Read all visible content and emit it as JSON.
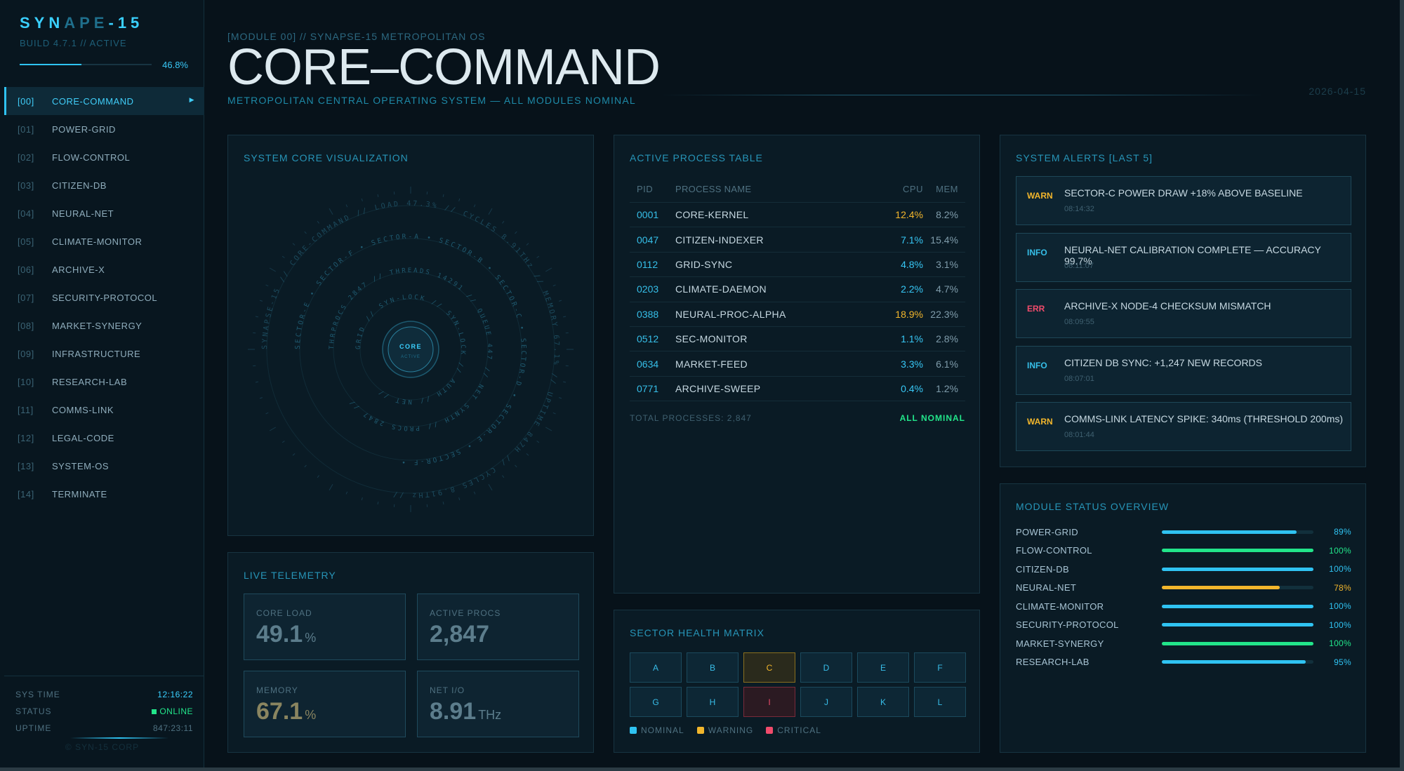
{
  "brand": {
    "part1": "SYN",
    "part2": "APE",
    "part3": "-15",
    "build": "BUILD 4.7.1 // ACTIVE",
    "progress_label": "46.8%",
    "progress": 0.468
  },
  "nav": [
    {
      "num": "[00]",
      "label": "CORE-COMMAND",
      "active": true
    },
    {
      "num": "[01]",
      "label": "POWER-GRID"
    },
    {
      "num": "[02]",
      "label": "FLOW-CONTROL"
    },
    {
      "num": "[03]",
      "label": "CITIZEN-DB"
    },
    {
      "num": "[04]",
      "label": "NEURAL-NET"
    },
    {
      "num": "[05]",
      "label": "CLIMATE-MONITOR"
    },
    {
      "num": "[06]",
      "label": "ARCHIVE-X"
    },
    {
      "num": "[07]",
      "label": "SECURITY-PROTOCOL"
    },
    {
      "num": "[08]",
      "label": "MARKET-SYNERGY"
    },
    {
      "num": "[09]",
      "label": "INFRASTRUCTURE"
    },
    {
      "num": "[10]",
      "label": "RESEARCH-LAB"
    },
    {
      "num": "[11]",
      "label": "COMMS-LINK"
    },
    {
      "num": "[12]",
      "label": "LEGAL-CODE"
    },
    {
      "num": "[13]",
      "label": "SYSTEM-OS"
    },
    {
      "num": "[14]",
      "label": "TERMINATE"
    }
  ],
  "nav_arrow": "▶",
  "sys": {
    "time_label": "SYS TIME",
    "time": "12:16:22",
    "status_label": "STATUS",
    "status": "ONLINE",
    "uptime_label": "UPTIME",
    "uptime": "847:23:11",
    "copyright": "© SYN-15 CORP"
  },
  "header": {
    "module": "[MODULE 00] // SYNAPSE-15 METROPOLITAN OS",
    "title": "CORE–COMMAND",
    "subtitle": "METROPOLITAN CENTRAL OPERATING SYSTEM — ALL MODULES NOMINAL",
    "date": "2026-04-15"
  },
  "core_viz": {
    "title": "SYSTEM CORE VISUALIZATION",
    "center_label": "CORE",
    "center_sub": "ACTIVE",
    "rings": [
      "SYNAPSE-15 // CORE-COMMAND // LOAD 47.3% // CYCLES 8.91THz // MEMORY 67.1% // UPTIME 847H // CYCLES 8.91THz //",
      "SECTOR-E • SECTOR-F • SECTOR-A • SECTOR-B • SECTOR-C • SECTOR-D • SECTOR-E • SECTOR-F •",
      "THRPROCS 2847 // THREADS 14291 // QUEUE 447 // NET SYNTH // PROCS 2847 //",
      "GRID // SYN-LOCK // SYN-LOCK // AUTH // NET //"
    ]
  },
  "telemetry": {
    "title": "LIVE TELEMETRY",
    "tiles": [
      {
        "label": "CORE LOAD",
        "value": "49.1",
        "unit": "%"
      },
      {
        "label": "ACTIVE PROCS",
        "value": "2,847",
        "unit": ""
      },
      {
        "label": "MEMORY",
        "value": "67.1",
        "unit": "%"
      },
      {
        "label": "NET I/O",
        "value": "8.91",
        "unit": "THz"
      }
    ]
  },
  "process_table": {
    "title": "ACTIVE PROCESS TABLE",
    "headers": {
      "pid": "PID",
      "name": "PROCESS NAME",
      "cpu": "CPU",
      "mem": "MEM"
    },
    "rows": [
      {
        "pid": "0001",
        "name": "CORE-KERNEL",
        "cpu": "12.4%",
        "mem": "8.2%",
        "hot": true
      },
      {
        "pid": "0047",
        "name": "CITIZEN-INDEXER",
        "cpu": "7.1%",
        "mem": "15.4%"
      },
      {
        "pid": "0112",
        "name": "GRID-SYNC",
        "cpu": "4.8%",
        "mem": "3.1%"
      },
      {
        "pid": "0203",
        "name": "CLIMATE-DAEMON",
        "cpu": "2.2%",
        "mem": "4.7%"
      },
      {
        "pid": "0388",
        "name": "NEURAL-PROC-ALPHA",
        "cpu": "18.9%",
        "mem": "22.3%",
        "hot": true
      },
      {
        "pid": "0512",
        "name": "SEC-MONITOR",
        "cpu": "1.1%",
        "mem": "2.8%"
      },
      {
        "pid": "0634",
        "name": "MARKET-FEED",
        "cpu": "3.3%",
        "mem": "6.1%"
      },
      {
        "pid": "0771",
        "name": "ARCHIVE-SWEEP",
        "cpu": "0.4%",
        "mem": "1.2%"
      }
    ],
    "total": "TOTAL PROCESSES: 2,847",
    "status": "ALL NOMINAL"
  },
  "sector_matrix": {
    "title": "SECTOR HEALTH MATRIX",
    "cells": [
      {
        "id": "A",
        "state": "nominal"
      },
      {
        "id": "B",
        "state": "nominal"
      },
      {
        "id": "C",
        "state": "warning"
      },
      {
        "id": "D",
        "state": "nominal"
      },
      {
        "id": "E",
        "state": "nominal"
      },
      {
        "id": "F",
        "state": "nominal"
      },
      {
        "id": "G",
        "state": "nominal"
      },
      {
        "id": "H",
        "state": "nominal"
      },
      {
        "id": "I",
        "state": "critical"
      },
      {
        "id": "J",
        "state": "nominal"
      },
      {
        "id": "K",
        "state": "nominal"
      },
      {
        "id": "L",
        "state": "nominal"
      }
    ],
    "legend": {
      "nominal": "NOMINAL",
      "warning": "WARNING",
      "critical": "CRITICAL"
    }
  },
  "alerts": {
    "title": "SYSTEM ALERTS [LAST 5]",
    "items": [
      {
        "level": "WARN",
        "kind": "warn",
        "message": "SECTOR-C POWER DRAW +18% ABOVE BASELINE",
        "time": "08:14:32"
      },
      {
        "level": "INFO",
        "kind": "info",
        "message": "NEURAL-NET CALIBRATION COMPLETE — ACCURACY 99.7%",
        "time": "08:11:07"
      },
      {
        "level": "ERR",
        "kind": "err",
        "message": "ARCHIVE-X NODE-4 CHECKSUM MISMATCH",
        "time": "08:09:55"
      },
      {
        "level": "INFO",
        "kind": "info",
        "message": "CITIZEN DB SYNC: +1,247 NEW RECORDS",
        "time": "08:07:01"
      },
      {
        "level": "WARN",
        "kind": "warn",
        "message": "COMMS-LINK LATENCY SPIKE: 340ms (THRESHOLD 200ms)",
        "time": "08:01:44"
      }
    ]
  },
  "module_status": {
    "title": "MODULE STATUS OVERVIEW",
    "items": [
      {
        "name": "POWER-GRID",
        "percent": 89,
        "label": "89%",
        "color": "#2fc3f2"
      },
      {
        "name": "FLOW-CONTROL",
        "percent": 100,
        "label": "100%",
        "color": "#22e58a"
      },
      {
        "name": "CITIZEN-DB",
        "percent": 100,
        "label": "100%",
        "color": "#2fc3f2"
      },
      {
        "name": "NEURAL-NET",
        "percent": 78,
        "label": "78%",
        "color": "#f2b62c"
      },
      {
        "name": "CLIMATE-MONITOR",
        "percent": 100,
        "label": "100%",
        "color": "#2fc3f2"
      },
      {
        "name": "SECURITY-PROTOCOL",
        "percent": 100,
        "label": "100%",
        "color": "#2fc3f2"
      },
      {
        "name": "MARKET-SYNERGY",
        "percent": 100,
        "label": "100%",
        "color": "#22e58a"
      },
      {
        "name": "RESEARCH-LAB",
        "percent": 95,
        "label": "95%",
        "color": "#2fc3f2"
      }
    ]
  },
  "colors": {
    "accent": "#2fc3f2",
    "nominal": "#2fc3f2",
    "warning": "#f2b62c",
    "critical": "#f04b6b",
    "ok": "#22e58a"
  }
}
